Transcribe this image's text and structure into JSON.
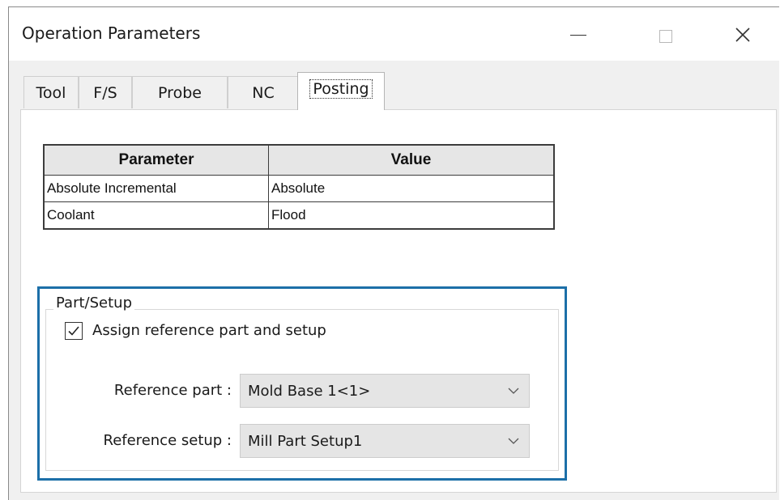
{
  "window": {
    "title": "Operation Parameters",
    "controls": [
      "minimize",
      "maximize",
      "close"
    ]
  },
  "tabs": [
    {
      "label": "Tool",
      "active": false
    },
    {
      "label": "F/S",
      "active": false
    },
    {
      "label": "Probe",
      "active": false
    },
    {
      "label": "NC",
      "active": false
    },
    {
      "label": "Posting",
      "active": true
    }
  ],
  "param_table": {
    "headers": [
      "Parameter",
      "Value"
    ],
    "rows": [
      [
        "Absolute Incremental",
        "Absolute"
      ],
      [
        "Coolant",
        "Flood"
      ]
    ]
  },
  "part_setup": {
    "legend": "Part/Setup",
    "assign_checkbox": {
      "label": "Assign reference part and setup",
      "checked": true
    },
    "reference_part": {
      "label": "Reference part :",
      "value": "Mold Base 1<1>"
    },
    "reference_setup": {
      "label": "Reference setup :",
      "value": "Mill Part Setup1"
    }
  },
  "colors": {
    "highlight_border": "#1c6fa8",
    "panel_bg": "#ffffff",
    "window_bg": "#f0f0f0"
  }
}
